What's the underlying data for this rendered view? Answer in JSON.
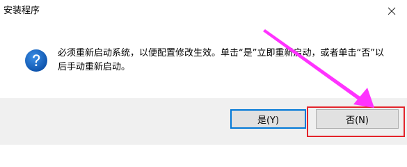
{
  "window": {
    "title": "安装程序"
  },
  "dialog": {
    "message": "必须重新启动系统，以便配置修改生效。单击“是”立即重新启动，或者单击“否”以后手动重新启动。",
    "icon": "question-icon"
  },
  "buttons": {
    "yes_label": "是(Y)",
    "no_label": "否(N)"
  },
  "annotation": {
    "arrow_color": "#ff33ff",
    "highlight_color": "#e3242b"
  }
}
